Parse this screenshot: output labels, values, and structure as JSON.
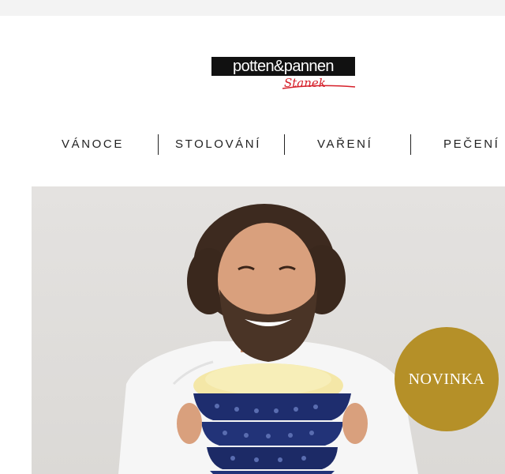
{
  "header": {
    "logo_text": "potten&pannen",
    "logo_signature": "Stanek"
  },
  "nav": {
    "items": [
      {
        "label": "VÁNOCE"
      },
      {
        "label": "STOLOVÁNÍ"
      },
      {
        "label": "VAŘENÍ"
      },
      {
        "label": "PEČENÍ"
      }
    ]
  },
  "hero": {
    "image_alt": "",
    "badge": "NOVINKA"
  },
  "colors": {
    "badge": "#b59028",
    "signature": "#d6202a",
    "bowl": "#1e2d6e"
  }
}
